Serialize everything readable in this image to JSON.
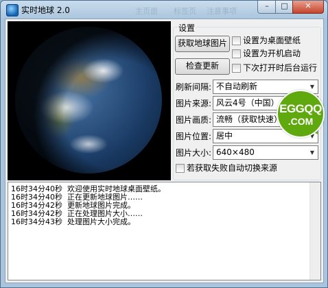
{
  "window": {
    "title": "实时地球 2.0",
    "ghost_menu": [
      "主页面",
      "标签页",
      "注意事项"
    ],
    "caption_buttons": {
      "minimize": "–",
      "maximize": "□",
      "close": "✕"
    }
  },
  "settings": {
    "group_title": "设置",
    "fetch_button": "获取地球图片",
    "update_button": "检查更新",
    "checkboxes": [
      {
        "label": "设置为桌面壁纸",
        "checked": false
      },
      {
        "label": "设置为开机启动",
        "checked": false
      },
      {
        "label": "下次打开时后台运行",
        "checked": false
      }
    ],
    "fields": [
      {
        "label": "刷新间隔:",
        "value": "不自动刷新"
      },
      {
        "label": "图片来源:",
        "value": "风云4号（中国）"
      },
      {
        "label": "图片画质:",
        "value": "流畅（获取快速）"
      },
      {
        "label": "图片位置:",
        "value": "居中"
      },
      {
        "label": "图片大小:",
        "value": "640×480"
      }
    ],
    "auto_switch_checkbox": {
      "label": "若获取失败自动切换来源",
      "checked": false
    }
  },
  "log": {
    "lines": [
      "16时34分40秒  欢迎使用实时地球桌面壁纸。",
      "16时34分40秒  正在更新地球图片……",
      "16时34分42秒  更新地球图片完成。",
      "16时34分42秒  正在处理图片大小……",
      "16时34分43秒  处理图片大小完成。"
    ]
  },
  "overlay_badge": {
    "line1": "EGGQQ",
    "line2": ".COM",
    "color": "#5fa90f"
  }
}
